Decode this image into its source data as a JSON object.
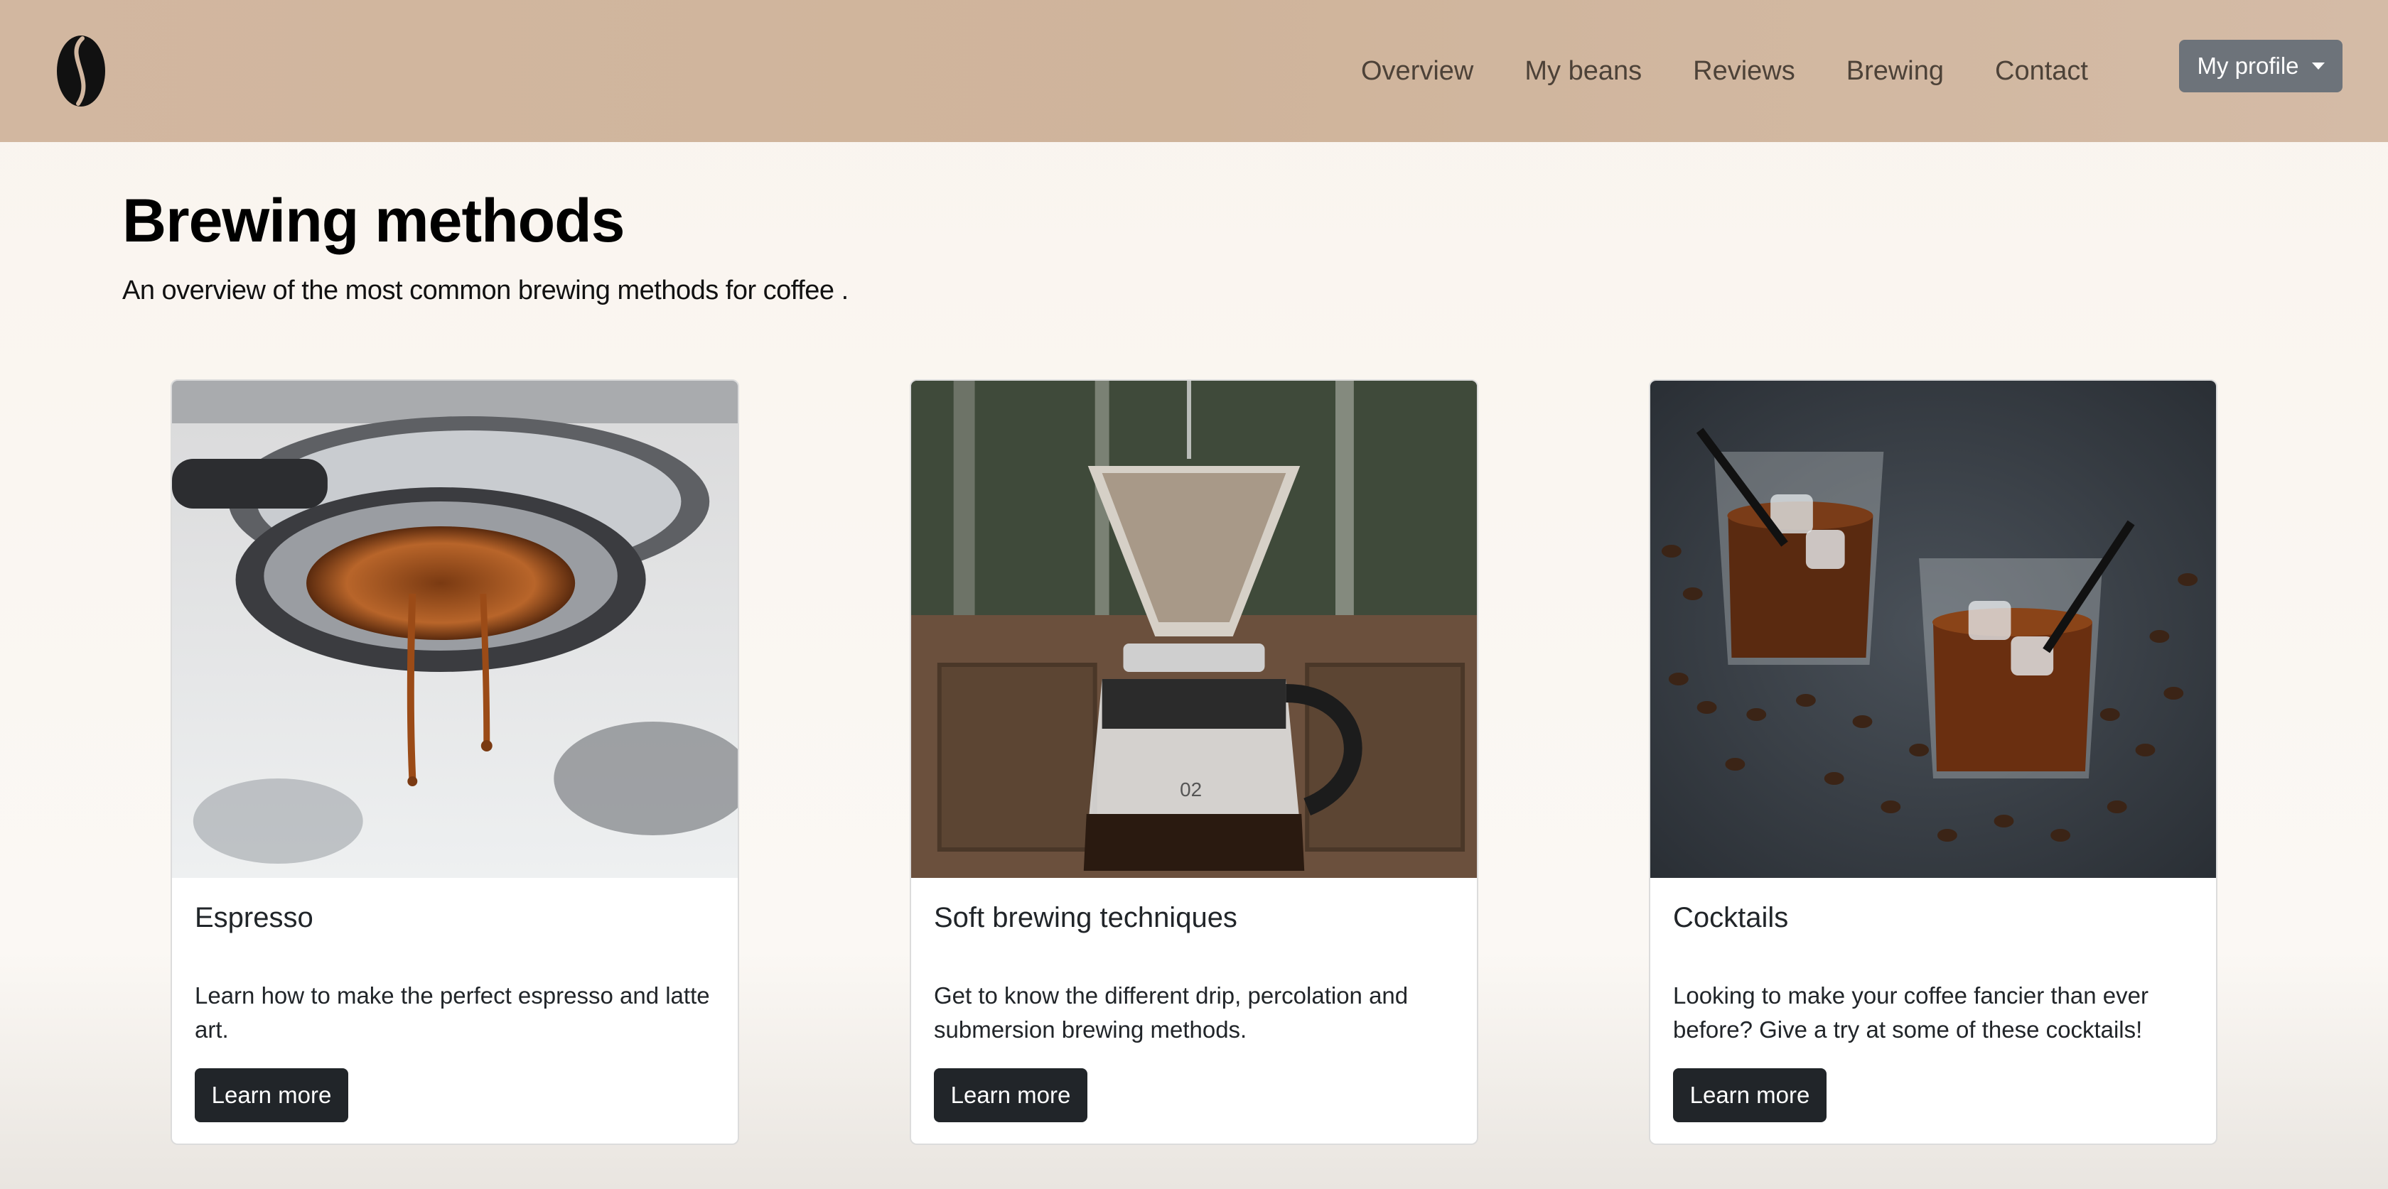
{
  "nav": {
    "logo_icon": "coffee-bean-icon",
    "links": [
      "Overview",
      "My beans",
      "Reviews",
      "Brewing",
      "Contact"
    ],
    "profile_label": "My profile"
  },
  "header": {
    "title": "Brewing methods",
    "subtitle": "An overview of the most common brewing methods for coffee ."
  },
  "cards": [
    {
      "title": "Espresso",
      "text": "Learn how to make the perfect espresso and latte art.",
      "button": "Learn more",
      "image": "espresso-machine-photo"
    },
    {
      "title": "Soft brewing techniques",
      "text": "Get to know the different drip, percolation and submersion brewing methods.",
      "button": "Learn more",
      "image": "pour-over-dripper-photo"
    },
    {
      "title": "Cocktails",
      "text": "Looking to make your coffee fancier than ever before? Give a try at some of these cocktails!",
      "button": "Learn more",
      "image": "iced-coffee-cocktails-photo"
    }
  ],
  "colors": {
    "navbar": "#cfb49b",
    "profile_button": "#6d737a",
    "card_button": "#212529",
    "page_background": "#faf6f1"
  }
}
